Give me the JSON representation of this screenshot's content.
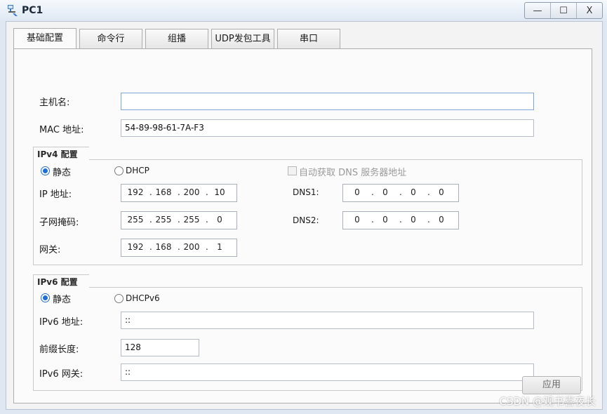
{
  "window": {
    "title": "PC1",
    "minimize": "—",
    "maximize": "☐",
    "close": "X"
  },
  "tabs": [
    {
      "label": "基础配置",
      "active": true
    },
    {
      "label": "命令行"
    },
    {
      "label": "组播"
    },
    {
      "label": "UDP发包工具"
    },
    {
      "label": "串口"
    }
  ],
  "basic": {
    "hostname_label": "主机名:",
    "hostname_value": "",
    "mac_label": "MAC 地址:",
    "mac_value": "54-89-98-61-7A-F3"
  },
  "ipv4": {
    "title": "IPv4 配置",
    "static_label": "静态",
    "dhcp_label": "DHCP",
    "auto_dns_label": "自动获取 DNS 服务器地址",
    "ip_label": "IP 地址:",
    "ip": [
      "192",
      "168",
      "200",
      "10"
    ],
    "mask_label": "子网掩码:",
    "mask": [
      "255",
      "255",
      "255",
      "0"
    ],
    "gateway_label": "网关:",
    "gateway": [
      "192",
      "168",
      "200",
      "1"
    ],
    "dns1_label": "DNS1:",
    "dns1": [
      "0",
      "0",
      "0",
      "0"
    ],
    "dns2_label": "DNS2:",
    "dns2": [
      "0",
      "0",
      "0",
      "0"
    ]
  },
  "ipv6": {
    "title": "IPv6 配置",
    "static_label": "静态",
    "dhcp_label": "DHCPv6",
    "addr_label": "IPv6 地址:",
    "addr_value": "::",
    "prefix_label": "前缀长度:",
    "prefix_value": "128",
    "gateway_label": "IPv6 网关:",
    "gateway_value": "::"
  },
  "apply_label": "应用",
  "watermark": "CSDN @观书喜夜长",
  "colors": {
    "accent": "#1f6fd1",
    "background": "#dfe7f2"
  }
}
